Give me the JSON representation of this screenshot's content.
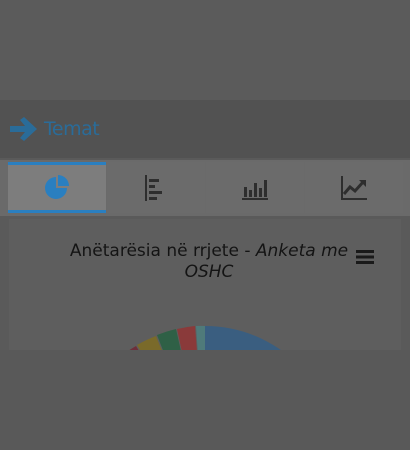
{
  "header": {
    "title": "Temat",
    "icon": "arrow-right-icon",
    "accent": "#2a6c99"
  },
  "tabs": [
    {
      "name": "pie-chart",
      "icon": "pie-chart-icon",
      "active": true
    },
    {
      "name": "horizontal-bar",
      "icon": "horizontal-bar-chart-icon",
      "active": false
    },
    {
      "name": "vertical-bar",
      "icon": "vertical-bar-chart-icon",
      "active": false
    },
    {
      "name": "line",
      "icon": "line-chart-icon",
      "active": false
    }
  ],
  "chart": {
    "title_main": "Anëtarësia në rrjete - ",
    "title_italic_1": "Anketa me",
    "title_italic_2": "OSHC",
    "menu_icon": "hamburger-menu-icon"
  },
  "colors": {
    "active_tab": "#2a7fc0",
    "pie_blue": "#3a5e80",
    "pie_red": "#8a3a3a",
    "pie_green": "#2f6046",
    "pie_olive": "#7a6a2a",
    "pie_teal": "#4f7a7a"
  }
}
